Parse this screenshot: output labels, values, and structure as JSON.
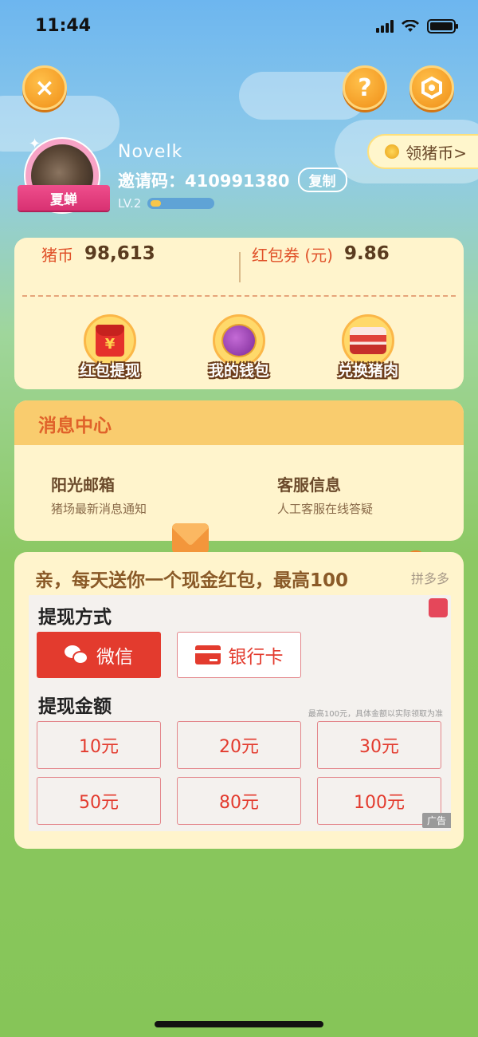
{
  "status": {
    "time": "11:44"
  },
  "top_buttons": {
    "close": "×",
    "help": "?"
  },
  "profile": {
    "username": "Novelk",
    "invite_label": "邀请码：",
    "invite_code": "410991380",
    "copy_label": "复制",
    "badge": "夏蝉",
    "level": "LV.2",
    "level_progress": 0.2,
    "claim_label": "领猪币>"
  },
  "balance": {
    "coins_label": "猪币",
    "coins_value": "98,613",
    "coupon_label": "红包券 (元)",
    "coupon_value": "9.86"
  },
  "actions": [
    {
      "label": "红包提现",
      "icon": "red-envelope-icon"
    },
    {
      "label": "我的钱包",
      "icon": "purse-icon"
    },
    {
      "label": "兑换猪肉",
      "icon": "pork-icon"
    }
  ],
  "messages": {
    "title": "消息中心",
    "items": [
      {
        "title": "阳光邮箱",
        "subtitle": "猪场最新消息通知",
        "icon": "mail-icon"
      },
      {
        "title": "客服信息",
        "subtitle": "人工客服在线答疑",
        "icon": "customer-service-icon"
      }
    ]
  },
  "ad": {
    "title": "亲，每天送你一个现金红包，最高100",
    "brand": "拼多多",
    "method_heading": "提现方式",
    "methods": [
      "微信",
      "银行卡"
    ],
    "amount_heading": "提现金额",
    "amount_note": "最高100元，具体金额以实际领取为准",
    "amounts": [
      "10元",
      "20元",
      "30元",
      "50元",
      "80元",
      "100元"
    ],
    "ad_tag": "广告"
  },
  "colors": {
    "accent_orange": "#f08f18",
    "red": "#e33b2e",
    "card_bg": "#fff4cc"
  }
}
